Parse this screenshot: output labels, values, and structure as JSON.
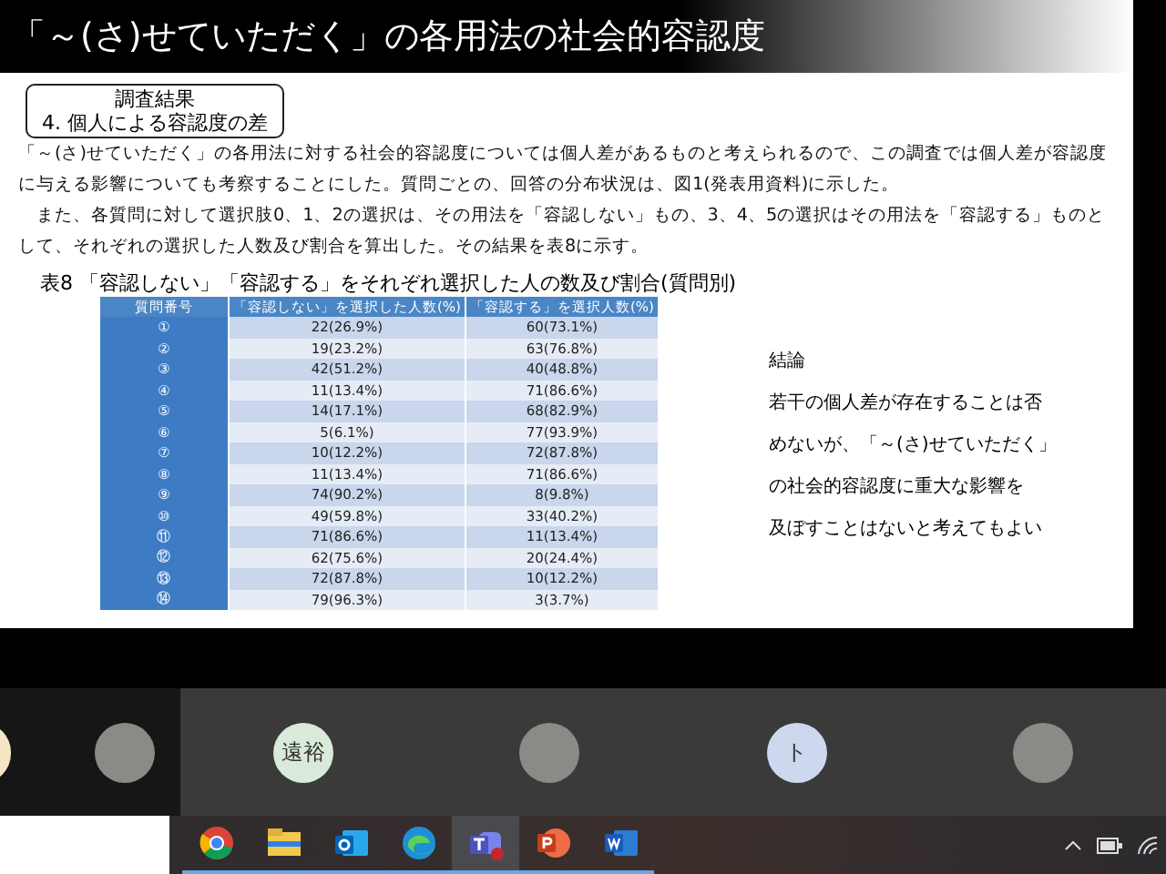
{
  "slide": {
    "title": "「～(さ)せていただく」の各用法の社会的容認度",
    "section_box": [
      "調査結果",
      "4. 個人による容認度の差"
    ],
    "paragraphs": [
      "「～(さ)せていただく」の各用法に対する社会的容認度については個人差があるものと考えられるので、この調査では個人差が容認度に与える影響についても考察することにした。質問ごとの、回答の分布状況は、図1(発表用資料)に示した。",
      "　また、各質問に対して選択肢0、1、2の選択は、その用法を「容認しない」もの、3、4、5の選択はその用法を「容認する」ものとして、それぞれの選択した人数及び割合を算出した。その結果を表8に示す。"
    ],
    "table_caption": "表8 「容認しない」「容認する」をそれぞれ選択した人の数及び割合(質問別)",
    "table": {
      "columns": [
        "質問番号",
        "「容認しない」を選択した人数(%)",
        "「容認する」を選択人数(%)"
      ],
      "rows": [
        [
          "①",
          "22(26.9%)",
          "60(73.1%)"
        ],
        [
          "②",
          "19(23.2%)",
          "63(76.8%)"
        ],
        [
          "③",
          "42(51.2%)",
          "40(48.8%)"
        ],
        [
          "④",
          "11(13.4%)",
          "71(86.6%)"
        ],
        [
          "⑤",
          "14(17.1%)",
          "68(82.9%)"
        ],
        [
          "⑥",
          "5(6.1%)",
          "77(93.9%)"
        ],
        [
          "⑦",
          "10(12.2%)",
          "72(87.8%)"
        ],
        [
          "⑧",
          "11(13.4%)",
          "71(86.6%)"
        ],
        [
          "⑨",
          "74(90.2%)",
          "8(9.8%)"
        ],
        [
          "⑩",
          "49(59.8%)",
          "33(40.2%)"
        ],
        [
          "⑪",
          "71(86.6%)",
          "11(13.4%)"
        ],
        [
          "⑫",
          "62(75.6%)",
          "20(24.4%)"
        ],
        [
          "⑬",
          "72(87.8%)",
          "10(12.2%)"
        ],
        [
          "⑭",
          "79(96.3%)",
          "3(3.7%)"
        ]
      ]
    },
    "conclusion": {
      "heading": "結論",
      "lines": [
        "若干の個人差が存在することは否",
        "めないが、「～(さ)せていただく」",
        "の社会的容認度に重大な影響を",
        "及ぼすことはないと考えてもよい"
      ]
    }
  },
  "participants": [
    {
      "kind": "photo"
    },
    {
      "kind": "initials",
      "text": "遠裕",
      "color": "#d9eadb"
    },
    {
      "kind": "photo"
    },
    {
      "kind": "initials",
      "text": "ト",
      "color": "#cdd8ef"
    },
    {
      "kind": "photo"
    }
  ],
  "taskbar": {
    "apps": [
      {
        "kind": "chrome",
        "selected": false
      },
      {
        "kind": "files",
        "selected": false
      },
      {
        "kind": "mail",
        "selected": false
      },
      {
        "kind": "browser",
        "selected": false
      },
      {
        "kind": "chat",
        "selected": true
      },
      {
        "kind": "slides",
        "selected": false
      },
      {
        "kind": "doc",
        "selected": false
      }
    ]
  }
}
